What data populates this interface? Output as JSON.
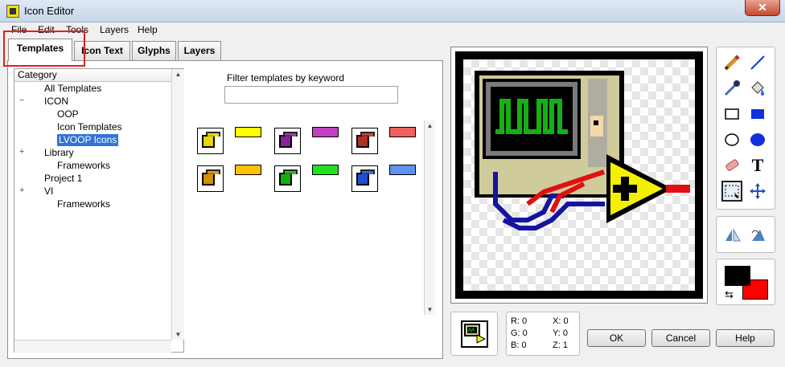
{
  "window": {
    "title": "Icon Editor",
    "close_symbol": "✕"
  },
  "menu": [
    "File",
    "Edit",
    "Tools",
    "Layers",
    "Help"
  ],
  "tabs": [
    "Templates",
    "Icon Text",
    "Glyphs",
    "Layers"
  ],
  "active_tab": "Templates",
  "category": {
    "header": "Category",
    "items": [
      {
        "label": "All Templates",
        "level": 1,
        "expander": ""
      },
      {
        "label": "ICON",
        "level": 1,
        "expander": "−"
      },
      {
        "label": "OOP",
        "level": 2,
        "expander": ""
      },
      {
        "label": "Icon Templates",
        "level": 2,
        "expander": ""
      },
      {
        "label": "LVOOP Icons",
        "level": 2,
        "expander": "",
        "selected": true
      },
      {
        "label": "Library",
        "level": 1,
        "expander": "+"
      },
      {
        "label": "Frameworks",
        "level": 2,
        "expander": ""
      },
      {
        "label": "Project 1",
        "level": 1,
        "expander": ""
      },
      {
        "label": "VI",
        "level": 1,
        "expander": "+"
      },
      {
        "label": "Frameworks",
        "level": 2,
        "expander": ""
      }
    ]
  },
  "filter": {
    "label": "Filter templates by keyword",
    "value": ""
  },
  "templates": [
    {
      "kind": "cube",
      "color": "#e6d800"
    },
    {
      "kind": "bar",
      "color": "#ffff00"
    },
    {
      "kind": "cube",
      "color": "#8a1fa0"
    },
    {
      "kind": "bar",
      "color": "#c040c0"
    },
    {
      "kind": "cube",
      "color": "#b03020"
    },
    {
      "kind": "bar",
      "color": "#f06060"
    },
    {
      "kind": "cube",
      "color": "#d09000"
    },
    {
      "kind": "bar",
      "color": "#ffc000"
    },
    {
      "kind": "cube",
      "color": "#10b010"
    },
    {
      "kind": "bar",
      "color": "#20e020"
    },
    {
      "kind": "cube",
      "color": "#2050d0"
    },
    {
      "kind": "bar",
      "color": "#6090f0"
    }
  ],
  "tools": [
    "pencil-icon",
    "line-icon",
    "dropper-icon",
    "fill-bucket-icon",
    "rectangle-icon",
    "filled-rectangle-icon",
    "ellipse-icon",
    "filled-ellipse-icon",
    "eraser-icon",
    "text-tool-icon",
    "select-icon",
    "move-icon"
  ],
  "flip_tools": [
    "flip-horizontal-icon",
    "flip-vertical-icon"
  ],
  "colors": {
    "foreground": "#000000",
    "background": "#ff0000",
    "swap_symbol": "⇆"
  },
  "coords": {
    "r": "R: 0",
    "g": "G: 0",
    "b": "B: 0",
    "x": "X: 0",
    "y": "Y: 0",
    "z": "Z: 1"
  },
  "buttons": {
    "ok": "OK",
    "cancel": "Cancel",
    "help": "Help"
  }
}
